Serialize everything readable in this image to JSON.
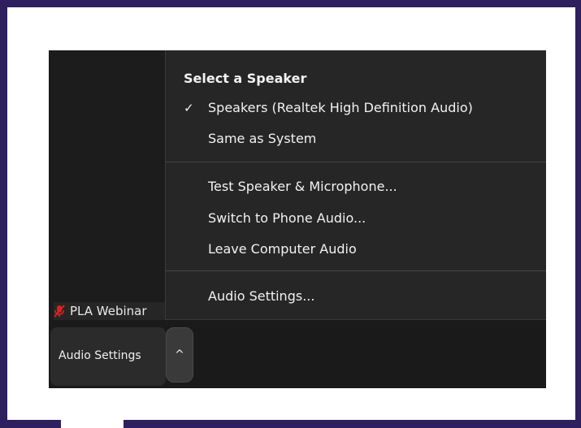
{
  "speaker_menu": {
    "heading": "Select a Speaker",
    "items": [
      {
        "label": "Speakers (Realtek High Definition Audio)",
        "checked": true
      },
      {
        "label": "Same as System",
        "checked": false
      }
    ],
    "check_icon": "✓"
  },
  "audio_actions": [
    "Test Speaker & Microphone...",
    "Switch to Phone Audio...",
    "Leave Computer Audio"
  ],
  "settings_item": "Audio Settings...",
  "participant": {
    "name": "PLA Webinar",
    "icon": "mic-muted-icon"
  },
  "toolbar": {
    "audio_settings_label": "Audio Settings",
    "chevron_glyph": "^"
  },
  "colors": {
    "frame": "#2e1f5e",
    "menu_background": "#262626",
    "window_background": "#1c1c1c",
    "muted_icon": "#e02020"
  }
}
